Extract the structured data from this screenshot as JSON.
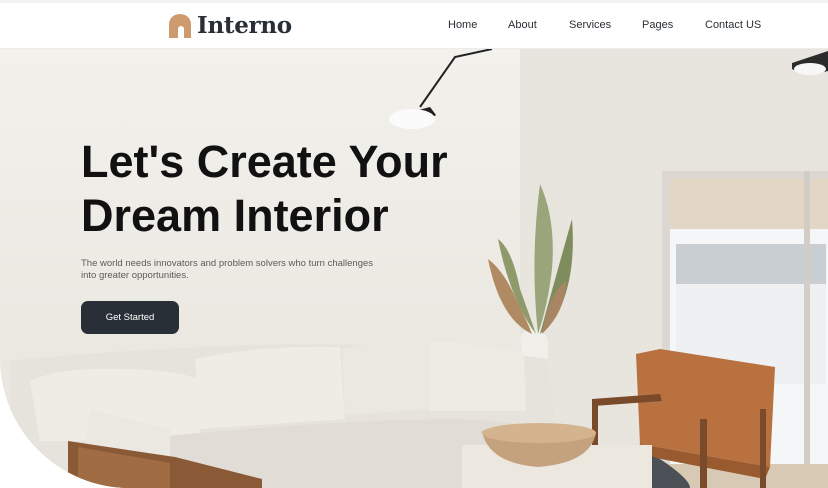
{
  "brand": {
    "name": "Interno",
    "logo_icon": "arch-house-icon",
    "accent": "#cd9b6d"
  },
  "nav": {
    "items": [
      {
        "label": "Home"
      },
      {
        "label": "About"
      },
      {
        "label": "Services"
      },
      {
        "label": "Pages"
      },
      {
        "label": "Contact US"
      }
    ]
  },
  "hero": {
    "headline_line1": "Let's Create Your",
    "headline_line2": "Dream Interior",
    "subtext": "The world needs innovators and problem solvers who turn challenges into greater opportunities.",
    "cta_label": "Get Started",
    "cta_color": "#292f36"
  }
}
